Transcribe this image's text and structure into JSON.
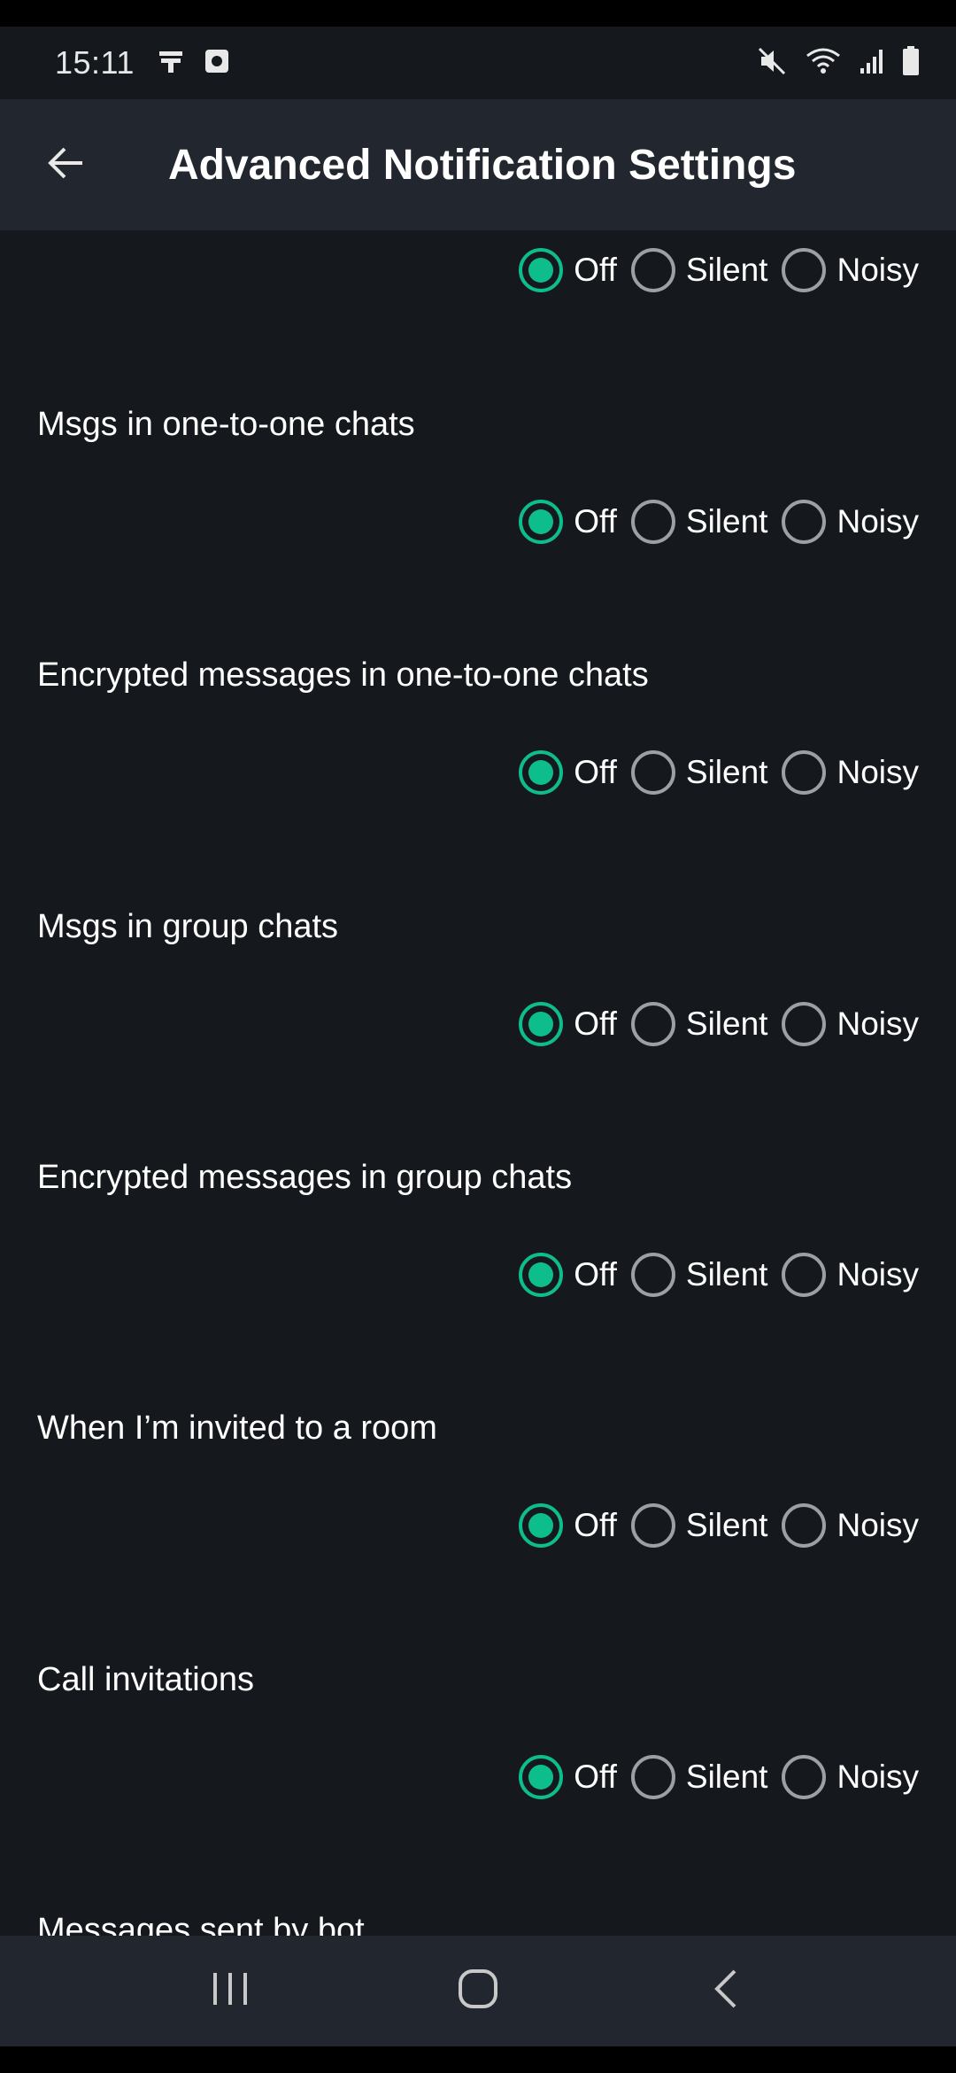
{
  "status_bar": {
    "time": "15:11",
    "left_icons": [
      "bar-gate-icon",
      "square-dot-icon"
    ],
    "right_icons": [
      "mute-icon",
      "wifi-icon",
      "signal-icon",
      "battery-icon"
    ]
  },
  "app_bar": {
    "back_icon": "back-arrow-icon",
    "title": "Advanced Notification Settings"
  },
  "options": {
    "off": "Off",
    "silent": "Silent",
    "noisy": "Noisy"
  },
  "settings": [
    {
      "label": "",
      "selected": "off"
    },
    {
      "label": "Msgs in one-to-one chats",
      "selected": "off"
    },
    {
      "label": "Encrypted messages in one-to-one chats",
      "selected": "off"
    },
    {
      "label": "Msgs in group chats",
      "selected": "off"
    },
    {
      "label": "Encrypted messages in group chats",
      "selected": "off"
    },
    {
      "label": "When I’m invited to a room",
      "selected": "off"
    },
    {
      "label": "Call invitations",
      "selected": "off"
    },
    {
      "label": "Messages sent by bot",
      "selected": ""
    }
  ],
  "colors": {
    "accent": "#0dbd8b",
    "unselected": "#9aa0a6",
    "background": "#15191e",
    "bar": "#22272f"
  },
  "nav_bar": {
    "icons": [
      "recent-apps-icon",
      "home-icon",
      "back-icon"
    ]
  }
}
